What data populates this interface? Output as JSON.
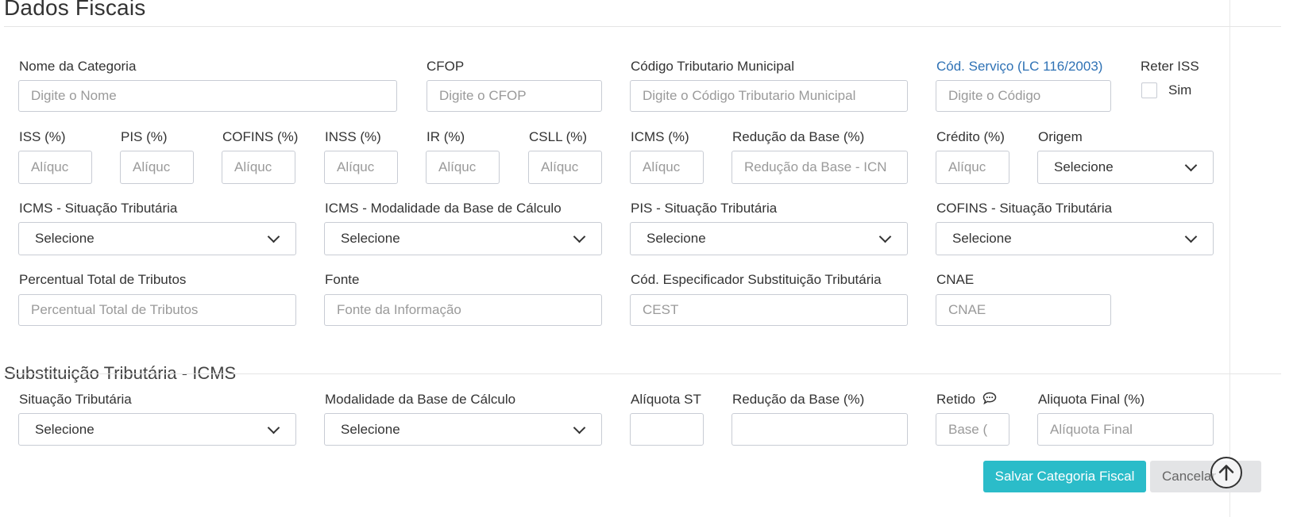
{
  "page": {
    "title": "Dados Fiscais",
    "section_st": "Substituição Tributária - ICMS"
  },
  "colors": {
    "accent": "#2bbcc9",
    "link": "#2f72b5",
    "border": "#c8ccd4"
  },
  "row1": {
    "nome_label": "Nome da Categoria",
    "nome_placeholder": "Digite o Nome",
    "cfop_label": "CFOP",
    "cfop_placeholder": "Digite o CFOP",
    "ctm_label": "Código Tributario Municipal",
    "ctm_placeholder": "Digite o Código Tributario Municipal",
    "cod_servico_label": "Cód. Serviço (LC 116/2003)",
    "cod_servico_placeholder": "Digite o Código",
    "reter_iss_label": "Reter ISS",
    "sim_label": "Sim"
  },
  "row2": {
    "iss_label": "ISS (%)",
    "pis_label": "PIS (%)",
    "cofins_label": "COFINS (%)",
    "inss_label": "INSS (%)",
    "ir_label": "IR (%)",
    "csll_label": "CSLL (%)",
    "icms_label": "ICMS (%)",
    "aliq_placeholder": "Alíquc",
    "reducao_label": "Redução da Base (%)",
    "reducao_placeholder": "Redução da Base - ICN",
    "credito_label": "Crédito (%)",
    "origem_label": "Origem",
    "origem_value": "Selecione"
  },
  "row3": {
    "icms_sit_label": "ICMS - Situação Tributária",
    "icms_mod_label": "ICMS - Modalidade da Base de Cálculo",
    "pis_sit_label": "PIS - Situação Tributária",
    "cofins_sit_label": "COFINS - Situação Tributária",
    "select_value": "Selecione"
  },
  "row4": {
    "perc_label": "Percentual Total de Tributos",
    "perc_placeholder": "Percentual Total de Tributos",
    "fonte_label": "Fonte",
    "fonte_placeholder": "Fonte da Informação",
    "cest_label": "Cód. Especificador Substituição Tributária",
    "cest_placeholder": "CEST",
    "cnae_label": "CNAE",
    "cnae_placeholder": "CNAE"
  },
  "st": {
    "sit_label": "Situação Tributária",
    "sit_value": "Selecione",
    "mod_label": "Modalidade da Base de Cálculo",
    "mod_value": "Selecione",
    "aliq_st_label": "Alíquota ST",
    "reducao_label": "Redução da Base (%)",
    "retido_label": "Retido",
    "retido_placeholder": "Base (",
    "aliq_final_label": "Aliquota Final (%)",
    "aliq_final_placeholder": "Alíquota Final"
  },
  "actions": {
    "save_label": "Salvar Categoria Fiscal",
    "cancel_label": "Cancelar"
  }
}
